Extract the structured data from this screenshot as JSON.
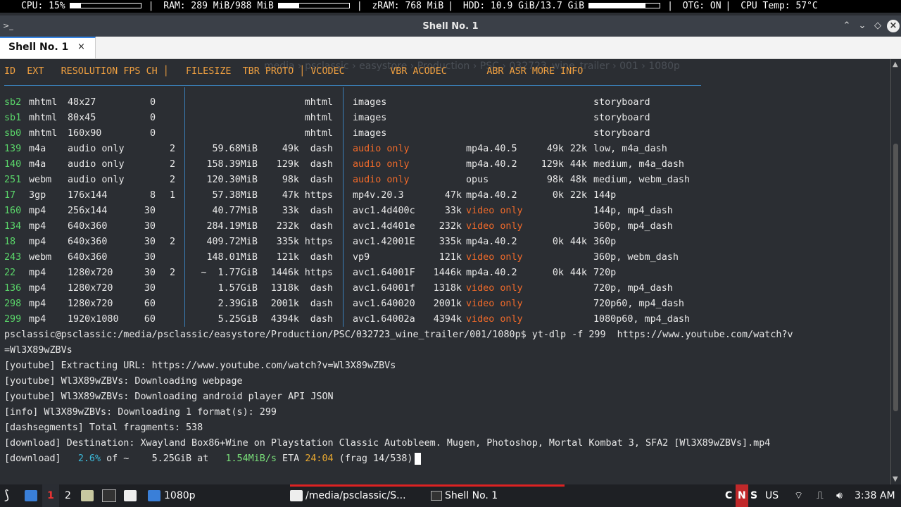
{
  "status": {
    "cpu": "CPU: 15%",
    "cpu_fill": 0.15,
    "ram": "RAM: 289 MiB/988 MiB",
    "ram_fill": 0.29,
    "zram": "zRAM: 768 MiB",
    "hdd": "HDD: 10.9 GiB/13.7 GiB",
    "hdd_fill": 0.8,
    "otg": "OTG: ON",
    "temp": "CPU Temp: 57°C"
  },
  "window": {
    "title": "Shell No. 1"
  },
  "tab": {
    "label": "Shell No. 1",
    "close": "×"
  },
  "terminal": {
    "header": {
      "id": "ID",
      "ext": "EXT",
      "res": "RESOLUTION",
      "fps": "FPS",
      "ch": "CH",
      "size": "FILESIZE",
      "tbr": "TBR",
      "proto": "PROTO",
      "vcodec": "VCODEC",
      "vbr": "VBR",
      "acodec": "ACODEC",
      "abr": "ABR",
      "asr": "ASR",
      "more": "MORE INFO"
    },
    "rows": [
      {
        "id": "sb2",
        "ext": "mhtml",
        "res": "48x27",
        "fps": "0",
        "ch": "",
        "size": "",
        "tbr": "",
        "proto": "mhtml",
        "vcodec": "images",
        "vbr": "",
        "acodec": "",
        "abr": "",
        "asr": "",
        "more": "storyboard",
        "vc_only": false,
        "ac_only": false
      },
      {
        "id": "sb1",
        "ext": "mhtml",
        "res": "80x45",
        "fps": "0",
        "ch": "",
        "size": "",
        "tbr": "",
        "proto": "mhtml",
        "vcodec": "images",
        "vbr": "",
        "acodec": "",
        "abr": "",
        "asr": "",
        "more": "storyboard",
        "vc_only": false,
        "ac_only": false
      },
      {
        "id": "sb0",
        "ext": "mhtml",
        "res": "160x90",
        "fps": "0",
        "ch": "",
        "size": "",
        "tbr": "",
        "proto": "mhtml",
        "vcodec": "images",
        "vbr": "",
        "acodec": "",
        "abr": "",
        "asr": "",
        "more": "storyboard",
        "vc_only": false,
        "ac_only": false
      },
      {
        "id": "139",
        "ext": "m4a",
        "res": "audio only",
        "fps": "",
        "ch": "2",
        "size": "59.68MiB",
        "tbr": "49k",
        "proto": "dash",
        "vcodec": "audio only",
        "vbr": "",
        "acodec": "mp4a.40.5",
        "abr": "49k",
        "asr": "22k",
        "more": "low, m4a_dash",
        "vc_only": true,
        "ac_only": false
      },
      {
        "id": "140",
        "ext": "m4a",
        "res": "audio only",
        "fps": "",
        "ch": "2",
        "size": "158.39MiB",
        "tbr": "129k",
        "proto": "dash",
        "vcodec": "audio only",
        "vbr": "",
        "acodec": "mp4a.40.2",
        "abr": "129k",
        "asr": "44k",
        "more": "medium, m4a_dash",
        "vc_only": true,
        "ac_only": false
      },
      {
        "id": "251",
        "ext": "webm",
        "res": "audio only",
        "fps": "",
        "ch": "2",
        "size": "120.30MiB",
        "tbr": "98k",
        "proto": "dash",
        "vcodec": "audio only",
        "vbr": "",
        "acodec": "opus",
        "abr": "98k",
        "asr": "48k",
        "more": "medium, webm_dash",
        "vc_only": true,
        "ac_only": false
      },
      {
        "id": "17",
        "ext": "3gp",
        "res": "176x144",
        "fps": "8",
        "ch": "1",
        "size": "57.38MiB",
        "tbr": "47k",
        "proto": "https",
        "vcodec": "mp4v.20.3",
        "vbr": "47k",
        "acodec": "mp4a.40.2",
        "abr": "0k",
        "asr": "22k",
        "more": "144p",
        "vc_only": false,
        "ac_only": false
      },
      {
        "id": "160",
        "ext": "mp4",
        "res": "256x144",
        "fps": "30",
        "ch": "",
        "size": "40.77MiB",
        "tbr": "33k",
        "proto": "dash",
        "vcodec": "avc1.4d400c",
        "vbr": "33k",
        "acodec": "video only",
        "abr": "",
        "asr": "",
        "more": "144p, mp4_dash",
        "vc_only": false,
        "ac_only": true
      },
      {
        "id": "134",
        "ext": "mp4",
        "res": "640x360",
        "fps": "30",
        "ch": "",
        "size": "284.19MiB",
        "tbr": "232k",
        "proto": "dash",
        "vcodec": "avc1.4d401e",
        "vbr": "232k",
        "acodec": "video only",
        "abr": "",
        "asr": "",
        "more": "360p, mp4_dash",
        "vc_only": false,
        "ac_only": true
      },
      {
        "id": "18",
        "ext": "mp4",
        "res": "640x360",
        "fps": "30",
        "ch": "2",
        "size": "409.72MiB",
        "tbr": "335k",
        "proto": "https",
        "vcodec": "avc1.42001E",
        "vbr": "335k",
        "acodec": "mp4a.40.2",
        "abr": "0k",
        "asr": "44k",
        "more": "360p",
        "vc_only": false,
        "ac_only": false
      },
      {
        "id": "243",
        "ext": "webm",
        "res": "640x360",
        "fps": "30",
        "ch": "",
        "size": "148.01MiB",
        "tbr": "121k",
        "proto": "dash",
        "vcodec": "vp9",
        "vbr": "121k",
        "acodec": "video only",
        "abr": "",
        "asr": "",
        "more": "360p, webm_dash",
        "vc_only": false,
        "ac_only": true
      },
      {
        "id": "22",
        "ext": "mp4",
        "res": "1280x720",
        "fps": "30",
        "ch": "2",
        "size": "~  1.77GiB",
        "tbr": "1446k",
        "proto": "https",
        "vcodec": "avc1.64001F",
        "vbr": "1446k",
        "acodec": "mp4a.40.2",
        "abr": "0k",
        "asr": "44k",
        "more": "720p",
        "vc_only": false,
        "ac_only": false
      },
      {
        "id": "136",
        "ext": "mp4",
        "res": "1280x720",
        "fps": "30",
        "ch": "",
        "size": "1.57GiB",
        "tbr": "1318k",
        "proto": "dash",
        "vcodec": "avc1.64001f",
        "vbr": "1318k",
        "acodec": "video only",
        "abr": "",
        "asr": "",
        "more": "720p, mp4_dash",
        "vc_only": false,
        "ac_only": true
      },
      {
        "id": "298",
        "ext": "mp4",
        "res": "1280x720",
        "fps": "60",
        "ch": "",
        "size": "2.39GiB",
        "tbr": "2001k",
        "proto": "dash",
        "vcodec": "avc1.640020",
        "vbr": "2001k",
        "acodec": "video only",
        "abr": "",
        "asr": "",
        "more": "720p60, mp4_dash",
        "vc_only": false,
        "ac_only": true
      },
      {
        "id": "299",
        "ext": "mp4",
        "res": "1920x1080",
        "fps": "60",
        "ch": "",
        "size": "5.25GiB",
        "tbr": "4394k",
        "proto": "dash",
        "vcodec": "avc1.64002a",
        "vbr": "4394k",
        "acodec": "video only",
        "abr": "",
        "asr": "",
        "more": "1080p60, mp4_dash",
        "vc_only": false,
        "ac_only": true
      }
    ],
    "prompt": "psclassic@psclassic:/media/psclassic/easystore/Production/PSC/032723_wine_trailer/001/1080p$ yt-dlp -f 299  https://www.youtube.com/watch?v",
    "prompt_cont": "=Wl3X89wZBVs",
    "log": [
      "[youtube] Extracting URL: https://www.youtube.com/watch?v=Wl3X89wZBVs",
      "[youtube] Wl3X89wZBVs: Downloading webpage",
      "[youtube] Wl3X89wZBVs: Downloading android player API JSON",
      "[info] Wl3X89wZBVs: Downloading 1 format(s): 299",
      "[dashsegments] Total fragments: 538",
      "[download] Destination: Xwayland Box86+Wine on Playstation Classic Autobleem. Mugen, Photoshop, Mortal Kombat 3, SFA2 [Wl3X89wZBVs].mp4"
    ],
    "progress": {
      "prefix": "[download]   ",
      "percent": "2.6%",
      "of": " of ~    5.25GiB at   ",
      "speed": "1.54MiB/s",
      "eta_label": " ETA ",
      "eta": "24:04",
      "frag": " (frag 14/538)"
    }
  },
  "taskbar": {
    "ws1": "1",
    "ws2": "2",
    "folder_label": "1080p",
    "task1": "/media/psclassic/S...",
    "task2": "Shell No. 1",
    "lang_c": "C",
    "lang_n": "N",
    "lang_s": "S",
    "layout": "US",
    "clock": "3:38 AM"
  }
}
